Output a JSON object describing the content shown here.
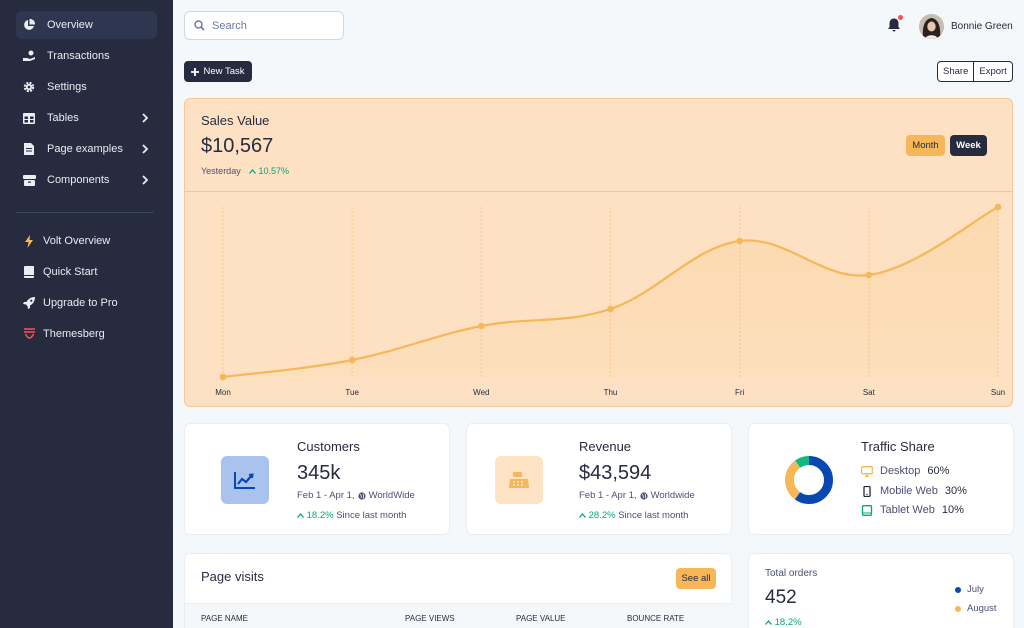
{
  "sidebar": {
    "items": [
      {
        "label": "Overview",
        "icon": "pie-chart-icon",
        "active": true
      },
      {
        "label": "Transactions",
        "icon": "hand-coins-icon"
      },
      {
        "label": "Settings",
        "icon": "gear-icon"
      },
      {
        "label": "Tables",
        "icon": "table-icon",
        "has_children": true
      },
      {
        "label": "Page examples",
        "icon": "document-icon",
        "has_children": true
      },
      {
        "label": "Components",
        "icon": "archive-icon",
        "has_children": true
      }
    ],
    "secondary": [
      {
        "label": "Volt Overview",
        "icon": "lightning-icon"
      },
      {
        "label": "Quick Start",
        "icon": "book-icon"
      },
      {
        "label": "Upgrade to Pro",
        "icon": "rocket-icon"
      },
      {
        "label": "Themesberg",
        "icon": "themesberg-logo-icon"
      }
    ]
  },
  "topbar": {
    "search_placeholder": "Search",
    "user_name": "Bonnie Green"
  },
  "actions": {
    "new_task": "New Task",
    "share": "Share",
    "export": "Export"
  },
  "sales": {
    "title": "Sales Value",
    "value": "$10,567",
    "period": "Yesterday",
    "change": "10.57%",
    "toggle_month": "Month",
    "toggle_week": "Week"
  },
  "chart_data": {
    "type": "line",
    "categories": [
      "Mon",
      "Tue",
      "Wed",
      "Thu",
      "Fri",
      "Sat",
      "Sun"
    ],
    "values": [
      0,
      10,
      30,
      40,
      80,
      60,
      100
    ],
    "ylim": [
      0,
      100
    ],
    "grid": "vertical-dashed",
    "color": "#f5b759"
  },
  "customers": {
    "title": "Customers",
    "value": "345k",
    "range": "Feb 1 - Apr 1,",
    "region": "WorldWide",
    "change": "18.2%",
    "change_label": "Since last month",
    "icon": "chart-line-icon"
  },
  "revenue": {
    "title": "Revenue",
    "value": "$43,594",
    "range": "Feb 1 - Apr 1,",
    "region": "Worldwide",
    "change": "28.2%",
    "change_label": "Since last month",
    "icon": "cash-register-icon"
  },
  "traffic": {
    "title": "Traffic Share",
    "segments": [
      {
        "label": "Desktop",
        "value": "60%",
        "fraction": 0.6,
        "color": "#0948b3",
        "icon": "desktop-icon"
      },
      {
        "label": "Mobile Web",
        "value": "30%",
        "fraction": 0.3,
        "color": "#f5b759",
        "icon": "mobile-icon"
      },
      {
        "label": "Tablet Web",
        "value": "10%",
        "fraction": 0.1,
        "color": "#10b981",
        "icon": "tablet-icon"
      }
    ]
  },
  "page_visits": {
    "title": "Page visits",
    "see_all": "See all",
    "columns": [
      "PAGE NAME",
      "PAGE VIEWS",
      "PAGE VALUE",
      "BOUNCE RATE"
    ]
  },
  "orders": {
    "title": "Total orders",
    "value": "452",
    "change": "18.2%",
    "legend": [
      {
        "label": "July",
        "color": "#0948b3"
      },
      {
        "label": "August",
        "color": "#f5b759"
      }
    ]
  }
}
